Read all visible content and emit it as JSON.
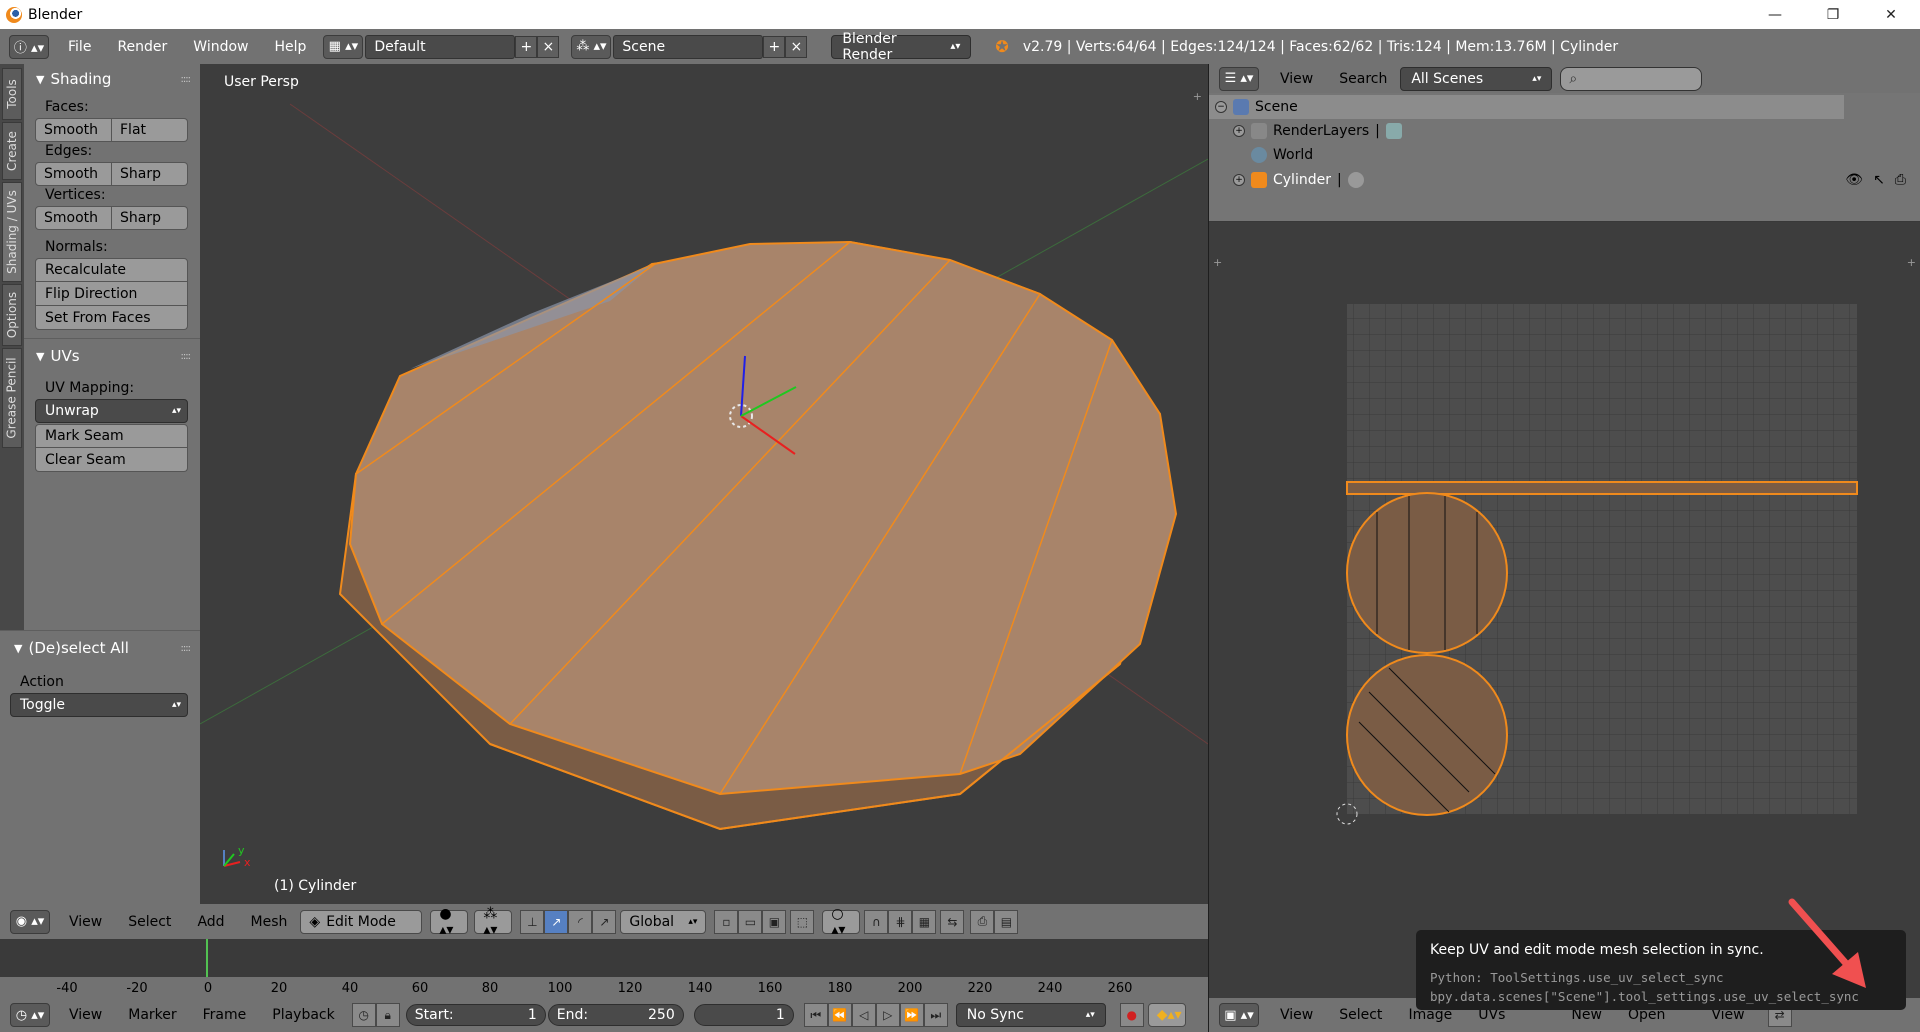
{
  "window": {
    "title": "Blender",
    "controls": [
      "—",
      "❐",
      "✕"
    ]
  },
  "info_header": {
    "menus": [
      "File",
      "Render",
      "Window",
      "Help"
    ],
    "layout": "Default",
    "scene": "Scene",
    "engine": "Blender Render",
    "stats": "v2.79 | Verts:64/64 | Edges:124/124 | Faces:62/62 | Tris:124 | Mem:13.76M | Cylinder"
  },
  "tabs": [
    "Tools",
    "Create",
    "Shading / UVs",
    "Options",
    "Grease Pencil"
  ],
  "toolshelf": {
    "shading": {
      "title": "Shading",
      "faces_label": "Faces:",
      "faces": [
        "Smooth",
        "Flat"
      ],
      "edges_label": "Edges:",
      "edges": [
        "Smooth",
        "Sharp"
      ],
      "vertices_label": "Vertices:",
      "vertices": [
        "Smooth",
        "Sharp"
      ],
      "normals_label": "Normals:",
      "normals": [
        "Recalculate",
        "Flip Direction",
        "Set From Faces"
      ]
    },
    "uvs": {
      "title": "UVs",
      "mapping_label": "UV Mapping:",
      "unwrap": "Unwrap",
      "mark_seam": "Mark Seam",
      "clear_seam": "Clear Seam"
    },
    "operator": {
      "title": "(De)select All",
      "action_label": "Action",
      "action_value": "Toggle"
    }
  },
  "viewport": {
    "view_label": "User Persp",
    "object_label": "(1) Cylinder",
    "axis_x": "x",
    "axis_y": "y"
  },
  "viewport_header": {
    "menus": [
      "View",
      "Select",
      "Add",
      "Mesh"
    ],
    "mode": "Edit Mode",
    "orientation": "Global"
  },
  "timeline": {
    "ticks": [
      "-40",
      "-20",
      "0",
      "20",
      "40",
      "60",
      "80",
      "100",
      "120",
      "140",
      "160",
      "180",
      "200",
      "220",
      "240",
      "260"
    ],
    "menus": [
      "View",
      "Marker",
      "Frame",
      "Playback"
    ],
    "start_label": "Start:",
    "start_value": "1",
    "end_label": "End:",
    "end_value": "250",
    "current_frame": "1",
    "sync": "No Sync"
  },
  "outliner": {
    "menus": [
      "View",
      "Search"
    ],
    "filter": "All Scenes",
    "items": [
      {
        "label": "Scene"
      },
      {
        "label": "RenderLayers"
      },
      {
        "label": "World"
      },
      {
        "label": "Cylinder"
      }
    ]
  },
  "uv_header": {
    "menus": [
      "View",
      "Select",
      "Image",
      "UVs"
    ],
    "new": "New",
    "open": "Open",
    "view": "View"
  },
  "tooltip": {
    "title": "Keep UV and edit mode mesh selection in sync.",
    "python": "Python: ToolSettings.use_uv_select_sync",
    "path": "bpy.data.scenes[\"Scene\"].tool_settings.use_uv_select_sync"
  },
  "colors": {
    "mesh_face": "#a8846a",
    "mesh_edge": "#f08a1c",
    "accent_blue": "#5680c2",
    "tooltip_arrow": "#f05050"
  }
}
